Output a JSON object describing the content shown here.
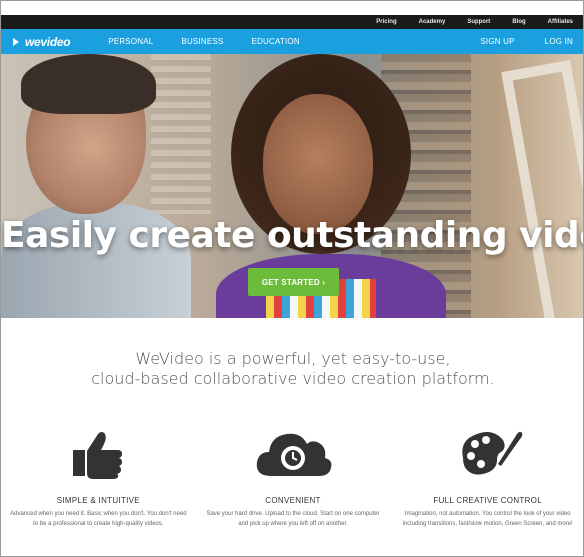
{
  "utility_nav": [
    "Pricing",
    "Academy",
    "Support",
    "Blog",
    "Affiliates"
  ],
  "logo": {
    "text": "wevideo"
  },
  "main_nav": {
    "left": [
      "PERSONAL",
      "BUSINESS",
      "EDUCATION"
    ],
    "right": [
      "SIGN UP",
      "LOG IN"
    ]
  },
  "hero": {
    "headline": "Easily create outstanding videos.",
    "cta_label": "GET STARTED ›",
    "platform_icons": [
      "android-icon",
      "apple-icon"
    ]
  },
  "tagline": {
    "line1": "WeVideo is a powerful, yet easy-to-use,",
    "line2": "cloud-based collaborative video creation platform."
  },
  "features": [
    {
      "icon": "thumbs-up-icon",
      "title": "SIMPLE & INTUITIVE",
      "desc": "Advanced when you need it. Basic when you don't. You don't need to be a professional to create high-quality videos."
    },
    {
      "icon": "cloud-clock-icon",
      "title": "CONVENIENT",
      "desc": "Save your hard drive. Upload to the cloud. Start on one computer and pick up where you left off on another."
    },
    {
      "icon": "palette-brush-icon",
      "title": "FULL CREATIVE CONTROL",
      "desc": "Imagination, not automation. You control the look of your video including transitions, fast/slow motion, Green Screen, and more!"
    }
  ],
  "colors": {
    "nav_blue": "#1aa0df",
    "cta_green": "#6dbb3a",
    "utility_black": "#1b1b1b"
  }
}
